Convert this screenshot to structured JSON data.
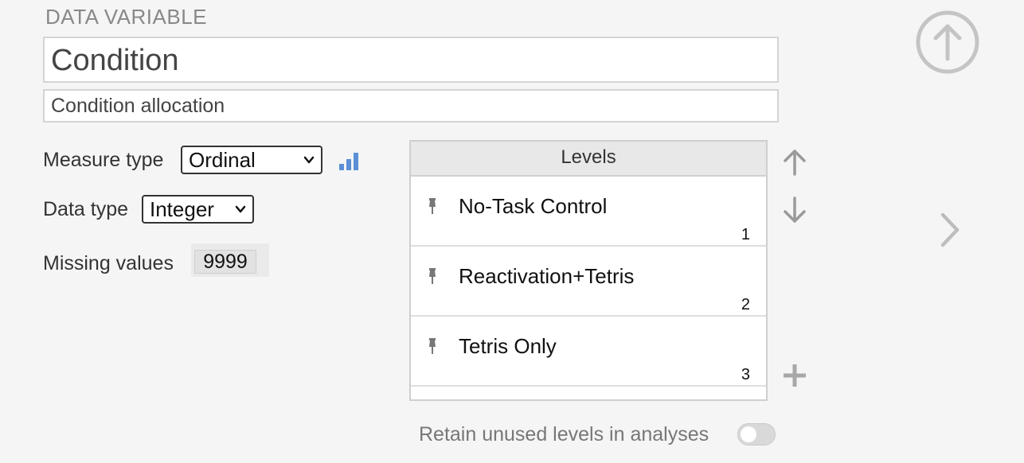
{
  "header": {
    "section_title": "DATA VARIABLE",
    "name_value": "Condition",
    "description_value": "Condition allocation"
  },
  "measure_type": {
    "label": "Measure type",
    "selected": "Ordinal",
    "icon": "ordinal-bars-icon",
    "accent_color": "#5b8fd6"
  },
  "data_type": {
    "label": "Data type",
    "selected": "Integer"
  },
  "missing_values": {
    "label": "Missing values",
    "value": "9999"
  },
  "levels": {
    "header": "Levels",
    "items": [
      {
        "label": "No-Task Control",
        "value": "1"
      },
      {
        "label": "Reactivation+Tetris",
        "value": "2"
      },
      {
        "label": "Tetris Only",
        "value": "3"
      }
    ]
  },
  "retain_unused": {
    "label": "Retain unused levels in analyses",
    "enabled": false
  },
  "icons": {
    "top_nav": "arrow-up-circle-icon",
    "move_up": "arrow-up-icon",
    "move_down": "arrow-down-icon",
    "add": "plus-icon",
    "next": "chevron-right-icon",
    "pin": "pin-icon"
  }
}
